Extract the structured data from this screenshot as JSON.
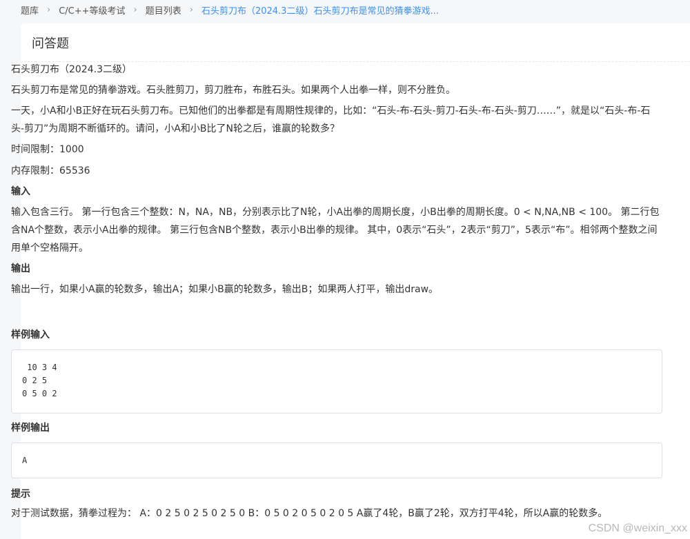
{
  "breadcrumb": {
    "items": [
      "题库",
      "C/C++等级考试",
      "题目列表"
    ],
    "current": "石头剪刀布（2024.3二级）石头剪刀布是常见的猜拳游戏..."
  },
  "card": {
    "title": "问答题"
  },
  "problem": {
    "title": "石头剪刀布（2024.3二级）",
    "intro": "石头剪刀布是常见的猜拳游戏。石头胜剪刀，剪刀胜布，布胜石头。如果两个人出拳一样，则不分胜负。",
    "story": "一天，小A和小B正好在玩石头剪刀布。已知他们的出拳都是有周期性规律的，比如：“石头-布-石头-剪刀-石头-布-石头-剪刀……”，就是以“石头-布-石头-剪刀”为周期不断循环的。请问，小A和小B比了N轮之后，谁赢的轮数多？",
    "time_limit": "时间限制：1000",
    "memory_limit": "内存限制：65536",
    "input_heading": "输入",
    "input_desc": "输入包含三行。 第一行包含三个整数：N，NA，NB，分别表示比了N轮，小A出拳的周期长度，小B出拳的周期长度。0 < N,NA,NB < 100。 第二行包含NA个整数，表示小A出拳的规律。 第三行包含NB个整数，表示小B出拳的规律。 其中，0表示“石头”，2表示“剪刀”，5表示“布”。相邻两个整数之间用单个空格隔开。",
    "output_heading": "输出",
    "output_desc": "输出一行，如果小A赢的轮数多，输出A；如果小B赢的轮数多，输出B；如果两人打平，输出draw。",
    "sample_input_heading": "样例输入",
    "sample_input": " 10 3 4\n0 2 5\n0 5 0 2",
    "sample_output_heading": "样例输出",
    "sample_output": "A",
    "hint_heading": "提示",
    "hint": "对于测试数据，猜拳过程为： A：0 2 5 0 2 5 0 2 5 0 B：0 5 0 2 0 5 0 2 0 5 A赢了4轮，B赢了2轮，双方打平4轮，所以A赢的轮数多。"
  },
  "watermark": "CSDN @weixin_xxx"
}
